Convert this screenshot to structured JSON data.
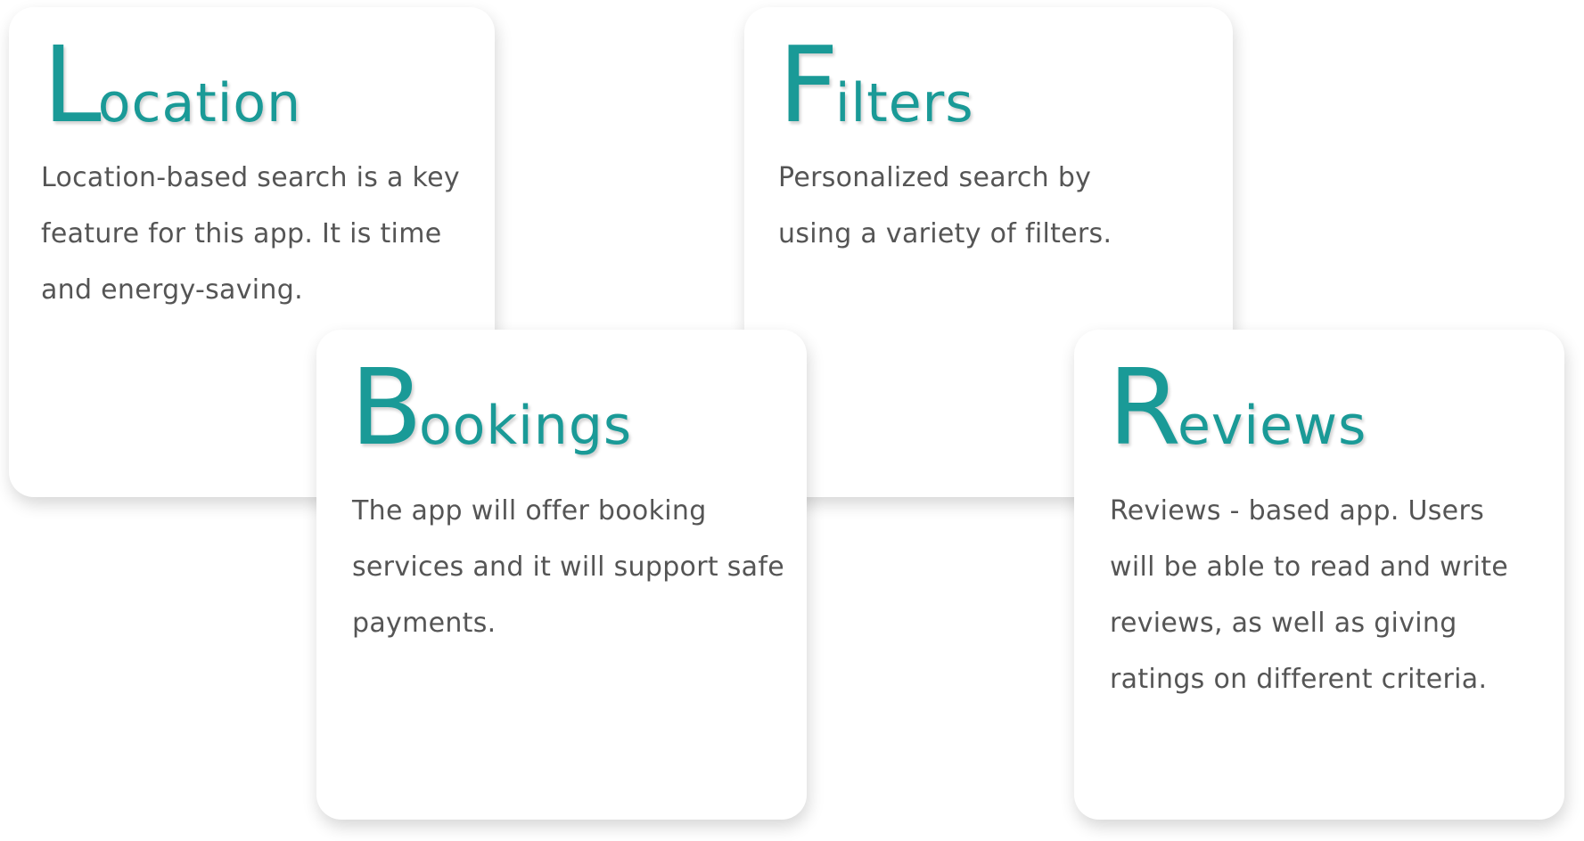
{
  "accent_color": "#1a9a97",
  "text_color": "#555555",
  "cards": [
    {
      "id": "location",
      "initial": "L",
      "rest": "ocation",
      "text": "Location-based search is a key feature for this app. It is time and energy-saving."
    },
    {
      "id": "filters",
      "initial": "F",
      "rest": "ilters",
      "text": "Personalized search by using a variety of filters."
    },
    {
      "id": "bookings",
      "initial": "B",
      "rest": "ookings",
      "text": "The app will offer booking services and it will support safe payments."
    },
    {
      "id": "reviews",
      "initial": "R",
      "rest": "eviews",
      "text": "Reviews - based app. Users will be able to read and write reviews, as well as giving ratings on different criteria."
    }
  ]
}
